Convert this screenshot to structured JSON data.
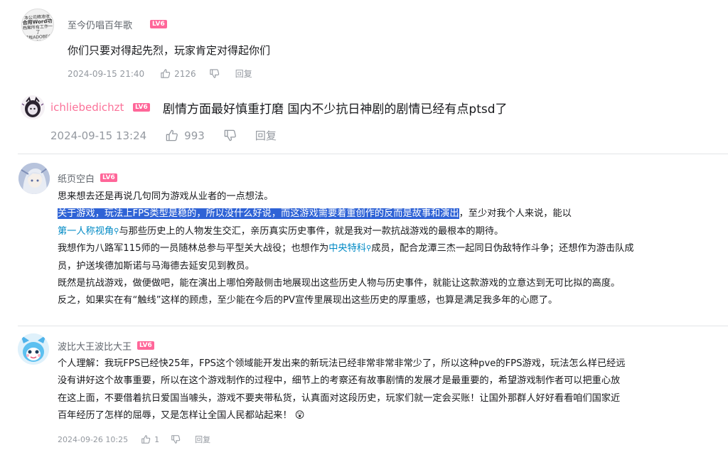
{
  "comments": [
    {
      "username": "至今仍唱百年歌",
      "level": "LV6",
      "avatar_lines": [
        "本公司精准收",
        "合用Word功",
        "档案所有工作一了",
        "模板ADOBE分时"
      ],
      "text": "你们只要对得起先烈，玩家肯定对得起你们",
      "time": "2024-09-15 21:40",
      "likes": "2126",
      "reply_label": "回复"
    },
    {
      "username": "ichliebedichzt",
      "level": "LV6",
      "text": "剧情方面最好慎重打磨 国内不少抗日神剧的剧情已经有点ptsd了",
      "time": "2024-09-15 13:24",
      "likes": "993",
      "reply_label": "回复"
    },
    {
      "username": "纸页空白",
      "level": "LV6",
      "lines": {
        "l1": "思来想去还是再说几句同为游戏从业者的一点想法。",
        "l2_highlight": "关于游戏，玩法上FPS类型是稳的，所以没什么好说，而这游戏需要着重创作的反而是故事和演出",
        "l2_rest": "，至少对我个人来说，能以",
        "l3_link": "第一人称视角",
        "l3_rest": "与那些历史上的人物发生交汇，亲历真实历史事件，就是我对一款抗战游戏的最根本的期待。",
        "l4_a": "我想作为八路军115师的一员随林总参与平型关大战役；也想作为",
        "l4_link": "中央特科",
        "l4_b": "成员，配合龙潭三杰一起同日伪敌特作斗争；还想作为游击队成",
        "l5": "员，护送埃德加斯诺与马海德去延安见到教员。",
        "l6": "既然是抗战游戏，做便做吧，能在演出上哪怕旁敲侧击地展现出这些历史人物与历史事件，就能让这款游戏的立意达到无可比拟的高度。",
        "l7": "反之，如果实在有“触线”这样的顾虑，至少能在今后的PV宣传里展现出这些历史的厚重感，也算是满足我多年的心愿了。"
      }
    },
    {
      "username": "波比大王波比大王",
      "level": "LV6",
      "lines": [
        "个人理解：我玩FPS已经快25年，FPS这个领域能开发出来的新玩法已经非常非常非常少了，所以这种pve的FPS游戏，玩法怎么样已经远",
        "没有讲好这个故事重要，所以在这个游戏制作的过程中，细节上的考察还有故事剧情的发展才是最重要的，希望游戏制作者可以把重心放",
        "在这上面，不要借着抗日爱国当噱头，游戏不要夹带私货，认真面对这段历史，玩家们就一定会买账！让国外那群人好好看看咱们国家近",
        "百年经历了怎样的屈辱，又是怎样让全国人民都站起来！"
      ],
      "emoji": "😲",
      "time": "2024-09-26 10:25",
      "likes": "1",
      "reply_label": "回复"
    }
  ],
  "colors": {
    "level_badge": "#ff6699",
    "link": "#008ac5",
    "highlight": "#2f63d6",
    "meta": "#9499a0"
  }
}
